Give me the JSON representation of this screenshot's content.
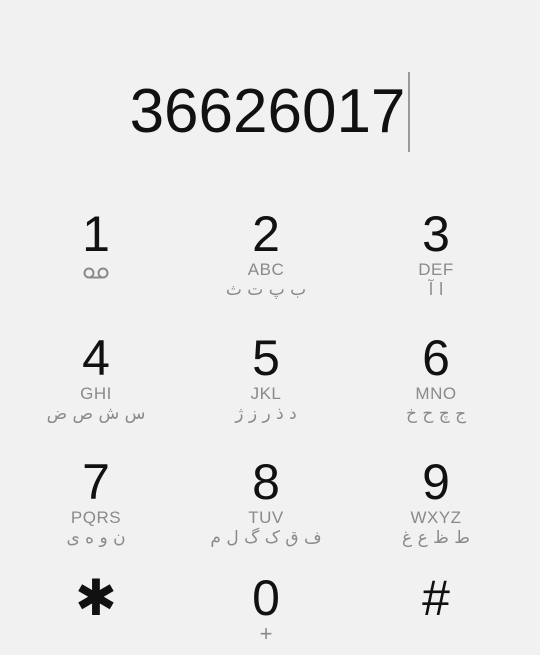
{
  "dialer": {
    "number": "36626017"
  },
  "keys": [
    {
      "digit": "1",
      "letters": "",
      "farsi": "",
      "icon": "voicemail-icon"
    },
    {
      "digit": "2",
      "letters": "ABC",
      "farsi": "ب پ ت ث"
    },
    {
      "digit": "3",
      "letters": "DEF",
      "farsi": "ا آ"
    },
    {
      "digit": "4",
      "letters": "GHI",
      "farsi": "س ش ص ض"
    },
    {
      "digit": "5",
      "letters": "JKL",
      "farsi": "د ذ ر ز ژ"
    },
    {
      "digit": "6",
      "letters": "MNO",
      "farsi": "ج چ ح خ"
    },
    {
      "digit": "7",
      "letters": "PQRS",
      "farsi": "ن و ه ی"
    },
    {
      "digit": "8",
      "letters": "TUV",
      "farsi": "ف ق ک گ ل م"
    },
    {
      "digit": "9",
      "letters": "WXYZ",
      "farsi": "ط ظ ع غ"
    },
    {
      "digit": "✱",
      "letters": "",
      "farsi": ""
    },
    {
      "digit": "0",
      "sub": "+"
    },
    {
      "digit": "#",
      "letters": "",
      "farsi": ""
    }
  ]
}
